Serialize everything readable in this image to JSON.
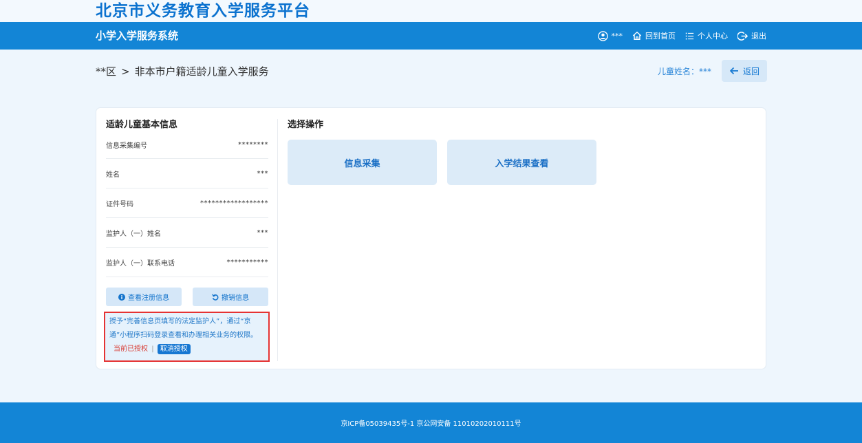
{
  "header": {
    "platform_title": "北京市义务教育入学服务平台",
    "system_name": "小学入学服务系统",
    "user_name": "***",
    "home_label": "回到首页",
    "profile_label": "个人中心",
    "logout_label": "退出"
  },
  "breadcrumb": {
    "district": "**区",
    "separator": ">",
    "current": "非本市户籍适龄儿童入学服务"
  },
  "child": {
    "name_label": "儿童姓名：***"
  },
  "back_button": {
    "label": "返回"
  },
  "info_panel": {
    "title": "适龄儿童基本信息",
    "rows": [
      {
        "label": "信息采集编号",
        "value": "********"
      },
      {
        "label": "姓名",
        "value": "***"
      },
      {
        "label": "证件号码",
        "value": "******************"
      },
      {
        "label": "监护人（一）姓名",
        "value": "***"
      },
      {
        "label": "监护人（一）联系电话",
        "value": "***********"
      }
    ],
    "view_register_label": "查看注册信息",
    "cancel_info_label": "撤销信息"
  },
  "authorization": {
    "text": "授予“完善信息页填写的法定监护人”，通过“京通”小程序扫码登录查看和办理相关业务的权限。",
    "status": "当前已授权",
    "divider": "|",
    "revoke_label": "取消授权"
  },
  "operations": {
    "title": "选择操作",
    "collect_label": "信息采集",
    "result_label": "入学结果查看"
  },
  "footer": {
    "icp": "京ICP备05039435号-1 京公网安备 11010202010111号"
  },
  "icons": [
    "user-icon",
    "home-icon",
    "list-icon",
    "logout-icon",
    "arrow-left-icon",
    "info-icon",
    "undo-icon"
  ],
  "colors": {
    "brand_blue": "#1385d6",
    "title_blue": "#0b72cf",
    "page_bg": "#eef6fd",
    "button_bg": "#dcebf8",
    "alert_red": "#e53333"
  }
}
